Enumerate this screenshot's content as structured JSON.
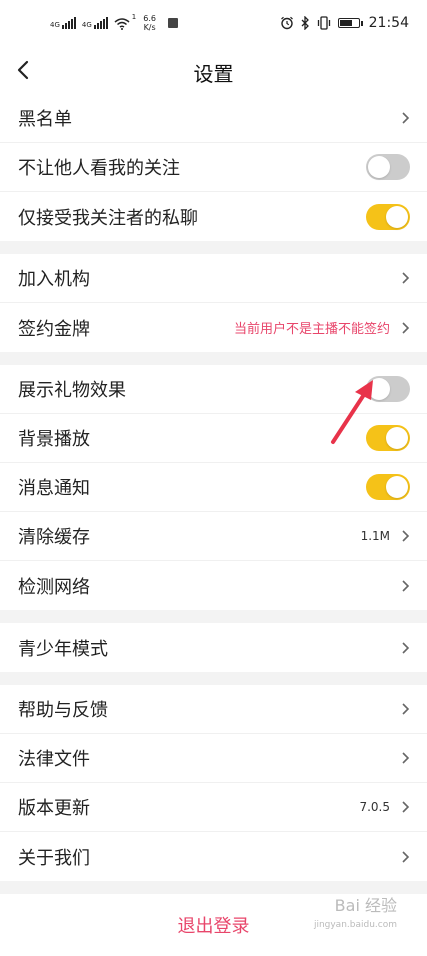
{
  "status_bar": {
    "sim1": "4G",
    "sim2": "4G",
    "wifi_level": "1",
    "speed_value": "6.6",
    "speed_unit": "K/s",
    "time": "21:54"
  },
  "header": {
    "title": "设置"
  },
  "sections": [
    {
      "rows": [
        {
          "label": "黑名单",
          "type": "link"
        },
        {
          "label": "不让他人看我的关注",
          "type": "toggle",
          "on": false
        },
        {
          "label": "仅接受我关注者的私聊",
          "type": "toggle",
          "on": true
        }
      ]
    },
    {
      "rows": [
        {
          "label": "加入机构",
          "type": "link"
        },
        {
          "label": "签约金牌",
          "type": "link",
          "value": "当前用户不是主播不能签约"
        }
      ]
    },
    {
      "rows": [
        {
          "label": "展示礼物效果",
          "type": "toggle",
          "on": false
        },
        {
          "label": "背景播放",
          "type": "toggle",
          "on": true
        },
        {
          "label": "消息通知",
          "type": "toggle",
          "on": true
        },
        {
          "label": "清除缓存",
          "type": "link",
          "value": "1.1M"
        },
        {
          "label": "检测网络",
          "type": "link"
        }
      ]
    },
    {
      "rows": [
        {
          "label": "青少年模式",
          "type": "link"
        }
      ]
    },
    {
      "rows": [
        {
          "label": "帮助与反馈",
          "type": "link"
        },
        {
          "label": "法律文件",
          "type": "link"
        },
        {
          "label": "版本更新",
          "type": "link",
          "value": "7.0.5"
        },
        {
          "label": "关于我们",
          "type": "link"
        }
      ]
    }
  ],
  "logout": {
    "label": "退出登录"
  },
  "watermark": {
    "text": "Bai 经验",
    "sub": "jingyan.baidu.com"
  },
  "colors": {
    "accent_toggle": "#f5c218",
    "toggle_off": "#cccccc",
    "pink": "#e8466b",
    "annotation_arrow": "#e8334a"
  }
}
